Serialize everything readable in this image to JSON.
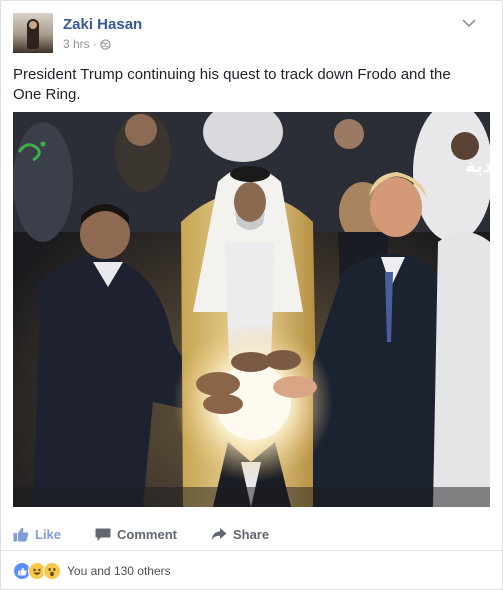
{
  "post": {
    "author": "Zaki Hasan",
    "time": "3 hrs",
    "separator": "·",
    "privacy_icon": "globe-icon",
    "text": "President Trump continuing his quest to track down Frodo and the One Ring."
  },
  "photo": {
    "overlay_text": "دية"
  },
  "actions": {
    "like": "Like",
    "comment": "Comment",
    "share": "Share"
  },
  "reactions": {
    "icons": [
      "like-icon",
      "haha-icon",
      "wow-icon"
    ],
    "summary": "You and 130 others"
  },
  "colors": {
    "author_link": "#365899",
    "meta_gray": "#90949c",
    "like_blue": "#7f9ed9",
    "action_gray": "#606770"
  }
}
